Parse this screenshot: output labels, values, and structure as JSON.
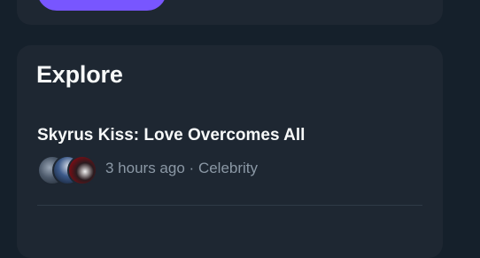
{
  "explore": {
    "title": "Explore",
    "items": [
      {
        "title": "Skyrus Kiss: Love Overcomes All",
        "time": "3 hours ago",
        "separator": "·",
        "category": "Celebrity"
      }
    ]
  },
  "colors": {
    "background": "#15202b",
    "card": "#1e2732",
    "accent": "#7856ff",
    "text_primary": "#f7f9f9",
    "text_secondary": "#8b98a5"
  }
}
